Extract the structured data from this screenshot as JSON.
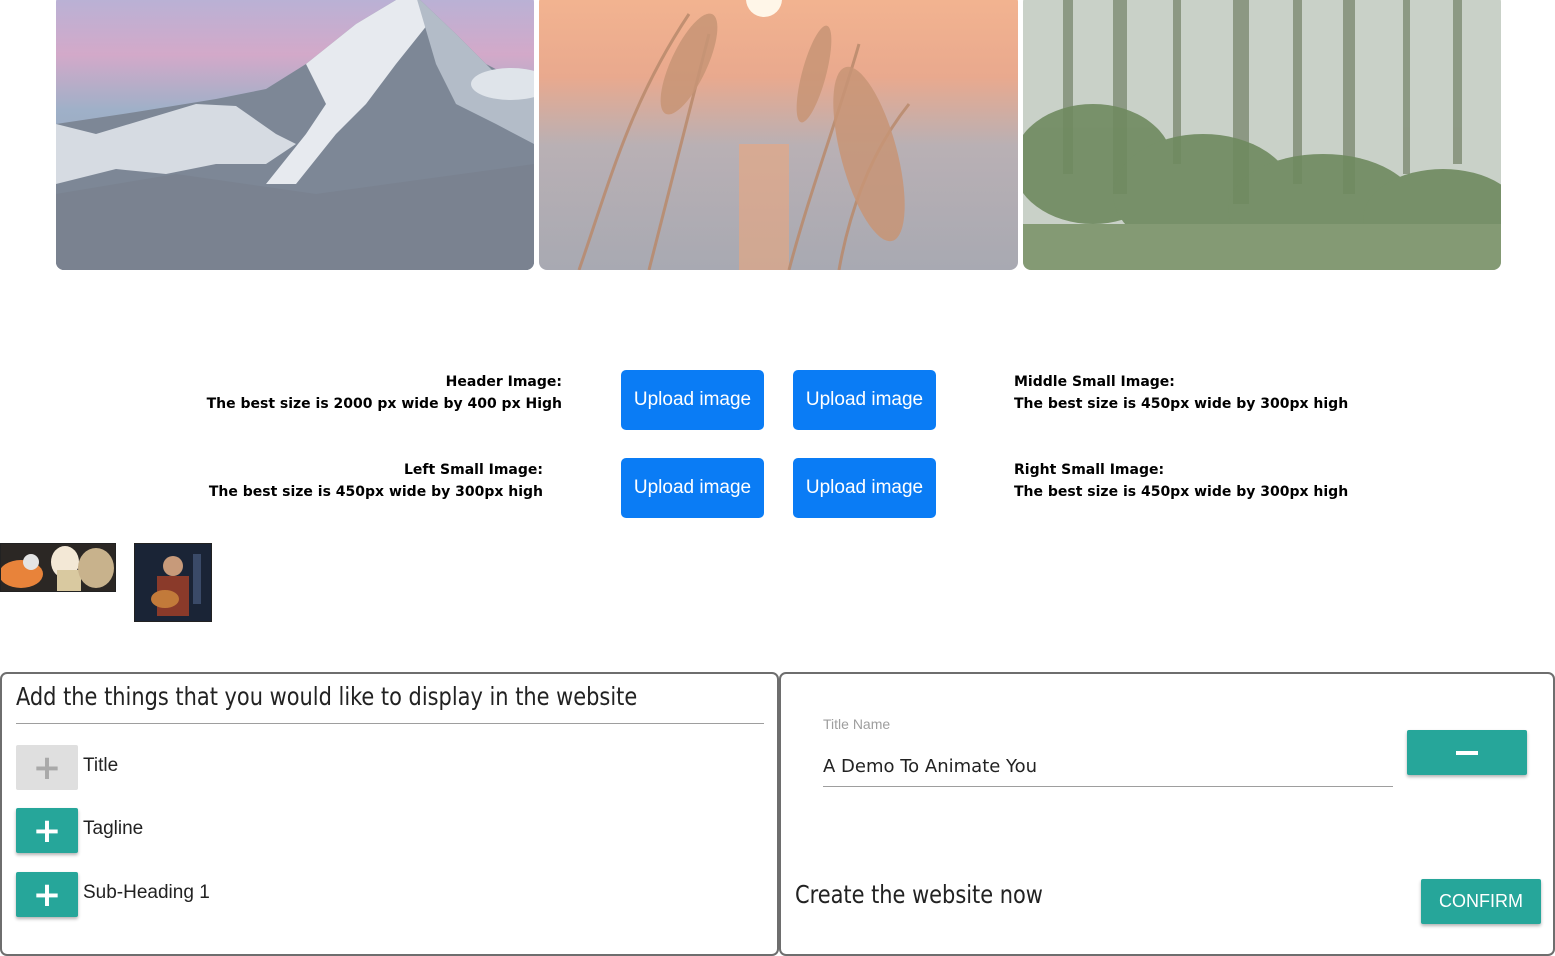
{
  "hero_images": [
    {
      "name": "mountain-image"
    },
    {
      "name": "sunset-grass-image"
    },
    {
      "name": "forest-image"
    }
  ],
  "upload_section": {
    "header": {
      "title": "Header Image:",
      "hint": "The best size is 2000 px wide by 400 px High"
    },
    "left": {
      "title": "Left Small Image:",
      "hint": "The best size is 450px wide by 300px high"
    },
    "middle": {
      "title": "Middle Small Image:",
      "hint": "The best size is 450px wide by 300px high"
    },
    "right": {
      "title": "Right Small Image:",
      "hint": "The best size is 450px wide by 300px high"
    },
    "button_label": "Upload image",
    "button_color": "#0a7cf5"
  },
  "thumbnails": [
    {
      "name": "thumbnail-anime"
    },
    {
      "name": "thumbnail-portrait"
    }
  ],
  "elements_panel": {
    "heading": "Add the things that you would like to display in the website",
    "items": [
      {
        "label": "Title",
        "icon": "plus-icon",
        "state": "disabled"
      },
      {
        "label": "Tagline",
        "icon": "plus-icon",
        "state": "enabled"
      },
      {
        "label": "Sub-Heading 1",
        "icon": "plus-icon",
        "state": "enabled"
      }
    ],
    "accent_color": "#26a69a"
  },
  "editor_panel": {
    "field_label": "Title Name",
    "field_value": "A Demo To Animate You",
    "remove_icon": "minus-icon",
    "create_title": "Create the website now",
    "confirm_label": "CONFIRM"
  }
}
